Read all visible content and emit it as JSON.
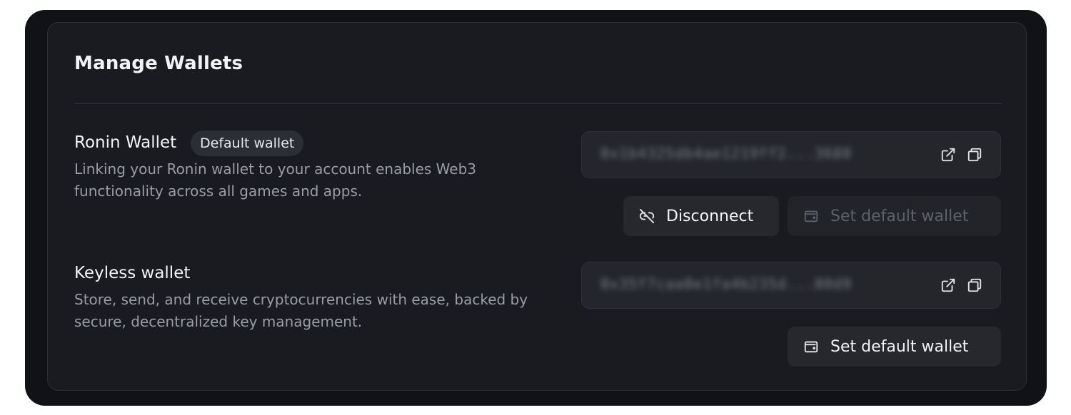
{
  "page": {
    "title": "Manage Wallets"
  },
  "wallets": [
    {
      "name": "Ronin Wallet",
      "badge": "Default wallet",
      "description": "Linking your Ronin wallet to your account enables Web3 functionality across all games and apps.",
      "address": "0x1b4325db4ae1219ff2...3680",
      "actions": {
        "disconnect_label": "Disconnect",
        "set_default_label": "Set default wallet"
      }
    },
    {
      "name": "Keyless wallet",
      "description": "Store, send, and receive cryptocurrencies with ease, backed by secure, decentralized key management.",
      "address": "0x35f7caa8e1fa4b235d...80d9",
      "actions": {
        "set_default_label": "Set default wallet"
      }
    }
  ],
  "colors": {
    "background": "#111216",
    "card": "#1a1b20",
    "field": "#24262c",
    "button": "#26282e",
    "text_primary": "#f2f3f5",
    "text_secondary": "#9a9ca6",
    "text_disabled": "#5e616b"
  },
  "icons": [
    "external-link-icon",
    "copy-icon",
    "unlink-icon",
    "wallet-icon"
  ]
}
